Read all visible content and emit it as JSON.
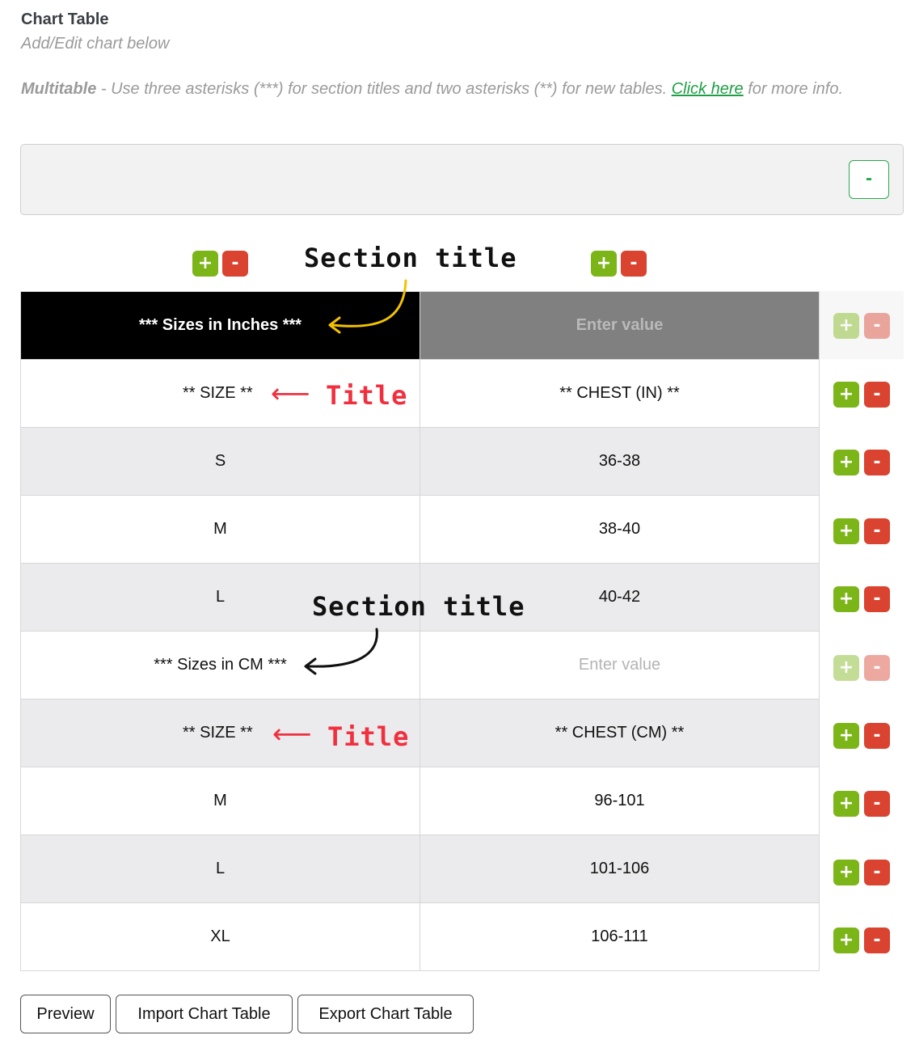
{
  "header": {
    "title": "Chart Table",
    "subtitle": "Add/Edit chart below"
  },
  "help": {
    "bold_label": "Multitable",
    "text": " - Use three asterisks (***) for section titles and two asterisks (**) for new tables. ",
    "link_text": "Click here",
    "tail": " for more info."
  },
  "collapse_button": "-",
  "icons": {
    "plus": "+",
    "minus": "-"
  },
  "annotations": {
    "section_title": "Section title",
    "title": "Title",
    "arrow": "⟵"
  },
  "colors": {
    "plus_green": "#7cb518",
    "minus_red": "#d9432f",
    "section_header_bg": "#000000",
    "link_green": "#1e9e44",
    "annotation_red": "#f0303f",
    "annotation_yellow": "#f2c200"
  },
  "table": {
    "rows": [
      {
        "c1": "*** Sizes in Inches ***",
        "c2": "Enter value",
        "kind": "section-header"
      },
      {
        "c1": "** SIZE **",
        "c2": "** CHEST (IN) **",
        "kind": "title"
      },
      {
        "c1": "S",
        "c2": "36-38"
      },
      {
        "c1": "M",
        "c2": "38-40"
      },
      {
        "c1": "L",
        "c2": "40-42"
      },
      {
        "c1": "*** Sizes in CM ***",
        "c2": "Enter value",
        "kind": "section"
      },
      {
        "c1": "** SIZE **",
        "c2": "** CHEST (CM) **",
        "kind": "title"
      },
      {
        "c1": "M",
        "c2": "96-101"
      },
      {
        "c1": "L",
        "c2": "101-106"
      },
      {
        "c1": "XL",
        "c2": "106-111"
      }
    ]
  },
  "buttons": {
    "preview": "Preview",
    "import": "Import Chart Table",
    "export": "Export Chart Table"
  }
}
